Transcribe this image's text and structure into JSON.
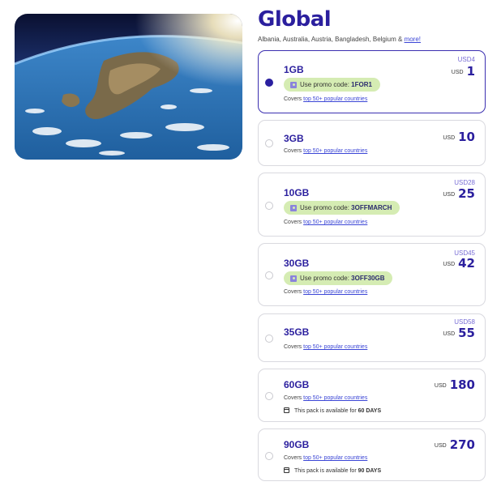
{
  "header": {
    "title": "Global",
    "countries_text": "Albania, Australia, Austria, Bangladesh, Belgium & ",
    "more_link": "more!"
  },
  "plans": [
    {
      "data": "1GB",
      "original_price": "USD4",
      "currency": "USD",
      "price": "1",
      "promo_prefix": "Use promo code: ",
      "promo_code": "1FOR1",
      "covers_prefix": "Covers ",
      "covers_link": "top 50+ popular countries",
      "selected": true
    },
    {
      "data": "3GB",
      "currency": "USD",
      "price": "10",
      "covers_prefix": "Covers ",
      "covers_link": "top 50+ popular countries",
      "selected": false
    },
    {
      "data": "10GB",
      "original_price": "USD28",
      "currency": "USD",
      "price": "25",
      "promo_prefix": "Use promo code: ",
      "promo_code": "3OFFMARCH",
      "covers_prefix": "Covers ",
      "covers_link": "top 50+ popular countries",
      "selected": false
    },
    {
      "data": "30GB",
      "original_price": "USD45",
      "currency": "USD",
      "price": "42",
      "promo_prefix": "Use promo code: ",
      "promo_code": "3OFF30GB",
      "covers_prefix": "Covers ",
      "covers_link": "top 50+ popular countries",
      "selected": false
    },
    {
      "data": "35GB",
      "original_price": "USD58",
      "currency": "USD",
      "price": "55",
      "covers_prefix": "Covers ",
      "covers_link": "top 50+ popular countries",
      "selected": false
    },
    {
      "data": "60GB",
      "currency": "USD",
      "price": "180",
      "covers_prefix": "Covers ",
      "covers_link": "top 50+ popular countries",
      "availability_prefix": "This pack is available for ",
      "availability_days": "60 DAYS",
      "selected": false
    },
    {
      "data": "90GB",
      "currency": "USD",
      "price": "270",
      "covers_prefix": "Covers ",
      "covers_link": "top 50+ popular countries",
      "availability_prefix": "This pack is available for ",
      "availability_days": "90 DAYS",
      "selected": false
    }
  ],
  "colors": {
    "brand": "#2b1f9e",
    "promo_bg": "#d5ecb3",
    "link": "#3b46d6"
  },
  "icons": {
    "promo": "tag-icon",
    "availability": "calendar-icon",
    "radio": "radio-icon"
  }
}
